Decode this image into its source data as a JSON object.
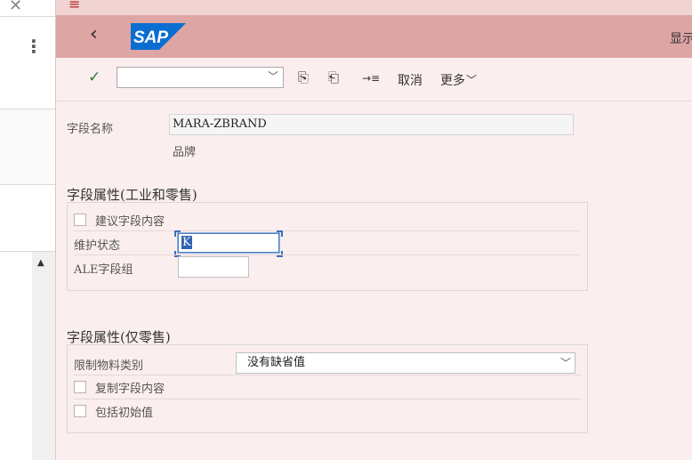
{
  "left_pane": {
    "close_icon": "close-icon",
    "more_icon": "vertical-ellipsis-icon",
    "scroll_up_icon": "triangle-up-icon"
  },
  "shell": {
    "menu_icon": "hamburger-icon",
    "back_glyph": "‹",
    "logo_text": "SAP",
    "title": "显示",
    "brand_color": "#0a6ed1",
    "shell_color": "#dea5a5"
  },
  "toolbar": {
    "confirm_glyph": "✓",
    "command_value": "",
    "cancel_label": "取消",
    "more_label": "更多"
  },
  "form": {
    "field_name_label": "字段名称",
    "field_name_value": "MARA-ZBRAND",
    "field_description": "品牌",
    "section1_title": "字段属性(工业和零售)",
    "suggest_label": "建议字段内容",
    "maint_status_label": "维护状态",
    "maint_status_value": "K",
    "ale_label": "ALE字段组",
    "ale_value": "",
    "section2_title": "字段属性(仅零售)",
    "restrict_label": "限制物料类别",
    "restrict_value": "没有缺省值",
    "copy_label": "复制字段内容",
    "include_label": "包括初始值"
  }
}
